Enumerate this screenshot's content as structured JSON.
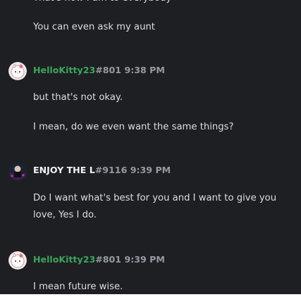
{
  "messages": {
    "partial_top": "That's how I am to everybody",
    "m1": "You can even ask my aunt",
    "g1": {
      "author": "HelloKitty23",
      "tag": "#801",
      "time": "9:38 PM",
      "lines": [
        "but that's not okay.",
        "I mean, do we even want the same things?"
      ]
    },
    "g2": {
      "author": "ENJOY THE L",
      "tag": "#9116",
      "time": "9:39 PM",
      "lines": [
        "Do I want what's best for you and I want to give you love, Yes I do."
      ]
    },
    "g3": {
      "author": "HelloKitty23",
      "tag": "#801",
      "time": "9:39 PM",
      "lines": [
        "I mean future wise."
      ]
    }
  },
  "colors": {
    "background": "#1e1f22",
    "author_green": "#3ba55c",
    "timestamp": "#949ba4",
    "text": "#dbdee1"
  }
}
